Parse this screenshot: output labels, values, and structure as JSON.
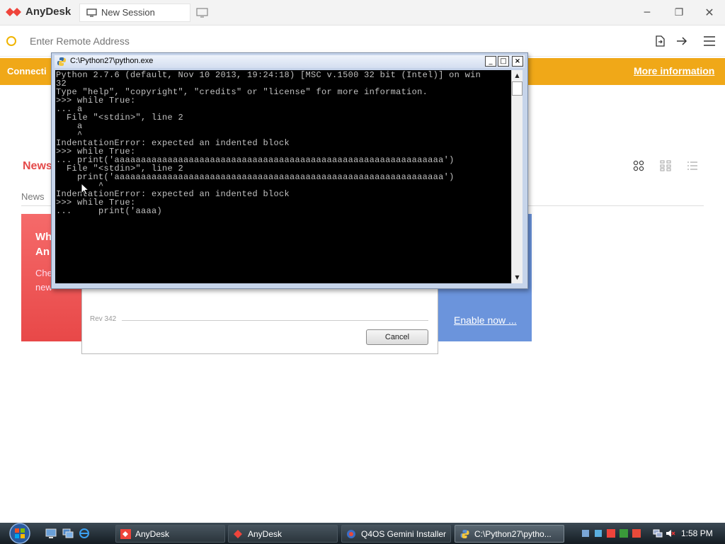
{
  "app": {
    "brand": "AnyDesk",
    "tab_label": "New Session",
    "address_placeholder": "Enter Remote Address",
    "banner_text": "Connecti",
    "banner_link": "More information",
    "accent": "#e44a4a",
    "banner_color": "#f0a818"
  },
  "content": {
    "news_heading": "News",
    "news_subtab": "News",
    "card_red_title": "Wh\nAn",
    "card_red_text": "Che\nnew",
    "enable_link": "Enable now ..."
  },
  "dialog": {
    "rev": "Rev 342",
    "cancel_label": "Cancel"
  },
  "console_window": {
    "title": "C:\\Python27\\python.exe",
    "lines": "Python 2.7.6 (default, Nov 10 2013, 19:24:18) [MSC v.1500 32 bit (Intel)] on win\n32\nType \"help\", \"copyright\", \"credits\" or \"license\" for more information.\n>>> while True:\n... a\n  File \"<stdin>\", line 2\n    a\n    ^\nIndentationError: expected an indented block\n>>> while True:\n... print('aaaaaaaaaaaaaaaaaaaaaaaaaaaaaaaaaaaaaaaaaaaaaaaaaaaaaaaaaaaaaa')\n  File \"<stdin>\", line 2\n    print('aaaaaaaaaaaaaaaaaaaaaaaaaaaaaaaaaaaaaaaaaaaaaaaaaaaaaaaaaaaaaa')\n        ^\nIndentationError: expected an indented block\n>>> while True:\n...     print('aaaa)"
  },
  "taskbar": {
    "items": [
      {
        "label": "AnyDesk"
      },
      {
        "label": "AnyDesk"
      },
      {
        "label": "Q4OS Gemini Installer"
      },
      {
        "label": "C:\\Python27\\pytho..."
      }
    ],
    "clock": "1:58 PM"
  }
}
